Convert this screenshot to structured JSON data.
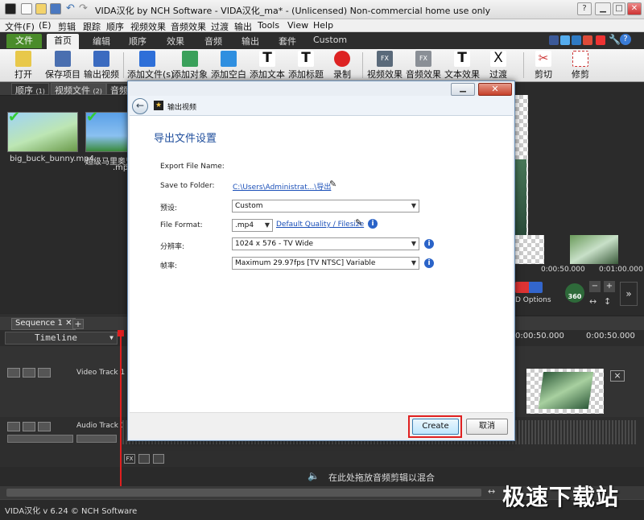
{
  "window": {
    "title": "VIDA汉化 by NCH Software - VIDA汉化_ma* - (Unlicensed) Non-commercial home use only"
  },
  "menu": [
    "文件(F)",
    "(E)",
    "剪辑",
    "跟踪",
    "顺序",
    "视频效果",
    "音频效果",
    "过渡",
    "输出",
    "Tools",
    "View",
    "Help"
  ],
  "ribbon_tabs": [
    "文件",
    "首页",
    "编辑",
    "顺序",
    "效果",
    "音频",
    "输出",
    "套件",
    "Custom"
  ],
  "ribbon": [
    "打开",
    "保存项目",
    "输出视频",
    "添加文件(s)",
    "添加对象",
    "添加空白",
    "添加文本",
    "添加标题",
    "录制",
    "视频效果",
    "音频效果",
    "文本效果",
    "过渡",
    "剪切",
    "修剪"
  ],
  "media_tabs": [
    {
      "label": "顺序",
      "count": "(1)"
    },
    {
      "label": "视频文件",
      "count": "(2)"
    },
    {
      "label": "音频"
    }
  ],
  "media_items": [
    {
      "name": "big_buck_bunny.mp4"
    },
    {
      "name": "超级马里奥兄",
      "name2": ".mp4"
    }
  ],
  "preview": {
    "time1": "0:00:50.000",
    "time2": "0:01:00.000",
    "options_label": "D Options",
    "badge_360": "360"
  },
  "sequence": {
    "tab": "Sequence 1",
    "timeline_label": "Timeline",
    "time_left": "0:00:50.000",
    "video_track": "Video Track 1",
    "audio_track": "Audio Track 1",
    "drop_hint": "在此处拖放音频剪辑以混合",
    "fx": "FX"
  },
  "status": {
    "version": "VIDA汉化 v 6.24 © NCH Software"
  },
  "watermark": "极速下载站",
  "dialog": {
    "title": "输出视频",
    "close": "✕",
    "heading": "导出文件设置",
    "export_file_name_label": "Export File Name:",
    "save_to_folder_label": "Save to Folder:",
    "save_to_folder_value": "C:\\Users\\Administrat...\\导出",
    "preset_label": "预设:",
    "preset_value": "Custom",
    "file_format_label": "File Format:",
    "file_format_value": ".mp4",
    "quality_link": "Default Quality / Filesize",
    "resolution_label": "分辨率:",
    "resolution_value": "1024 x 576 - TV Wide",
    "framerate_label": "帧率:",
    "framerate_value": "Maximum 29.97fps [TV NTSC] Variable",
    "create_button": "Create",
    "cancel_button": "取消"
  },
  "colors": {
    "accent_green": "#4a8c2a",
    "link_blue": "#1a4fb8",
    "highlight_red": "#e02020"
  }
}
